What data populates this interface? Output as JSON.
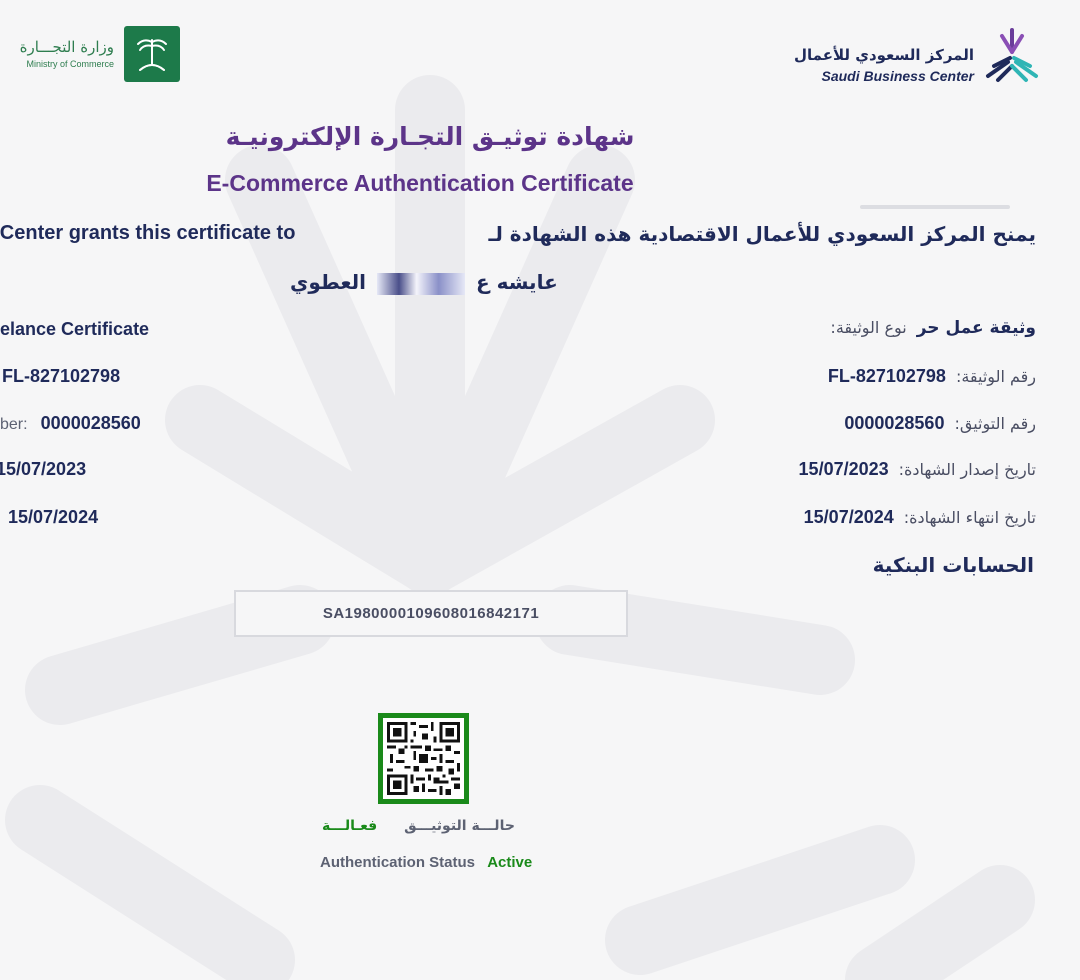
{
  "header": {
    "moc_name_ar": "وزارة التجـــارة",
    "moc_name_en": "Ministry of Commerce",
    "sbc_name_ar": "المركز السعودي للأعمال",
    "sbc_name_en": "Saudi Business Center"
  },
  "title_ar": "شهادة توثيـق التجـارة الإلكترونيـة",
  "title_en": "E-Commerce Authentication Certificate",
  "grants_en": "ss Center grants this certificate to",
  "grants_ar": "يمنح المركز السعودي للأعمال الاقتصادية هذه الشهادة لـ",
  "holder": {
    "first": "عايشه ع",
    "last": "العطوي"
  },
  "fields": [
    {
      "label_ar": "نوع الوثيقة:",
      "value_ar": "وثيقة عمل حر",
      "label_en": "",
      "value_en": "elance Certificate"
    },
    {
      "label_ar": "رقم الوثيقة:",
      "value_ar": "FL-827102798",
      "label_en": "",
      "value_en": "FL-827102798"
    },
    {
      "label_ar": "رقم التوثيق:",
      "value_ar": "0000028560",
      "label_en": "ber:",
      "value_en": "0000028560"
    },
    {
      "label_ar": "تاريخ إصدار الشهادة:",
      "value_ar": "15/07/2023",
      "label_en": "",
      "value_en": "15/07/2023"
    },
    {
      "label_ar": "تاريخ انتهاء الشهادة:",
      "value_ar": "15/07/2024",
      "label_en": "",
      "value_en": "15/07/2024"
    }
  ],
  "bank_heading": "الحسابات البنكية",
  "iban": "SA1980000109608016842171",
  "status": {
    "label_ar": "حالـــة التوثيـــق",
    "value_ar": "فعـالـــة",
    "label_en": "Authentication Status",
    "value_en": "Active"
  },
  "colors": {
    "title": "#5c3489",
    "text": "#1f2a5a",
    "active": "#1a8a1a",
    "moc_green": "#1d7a4a"
  }
}
